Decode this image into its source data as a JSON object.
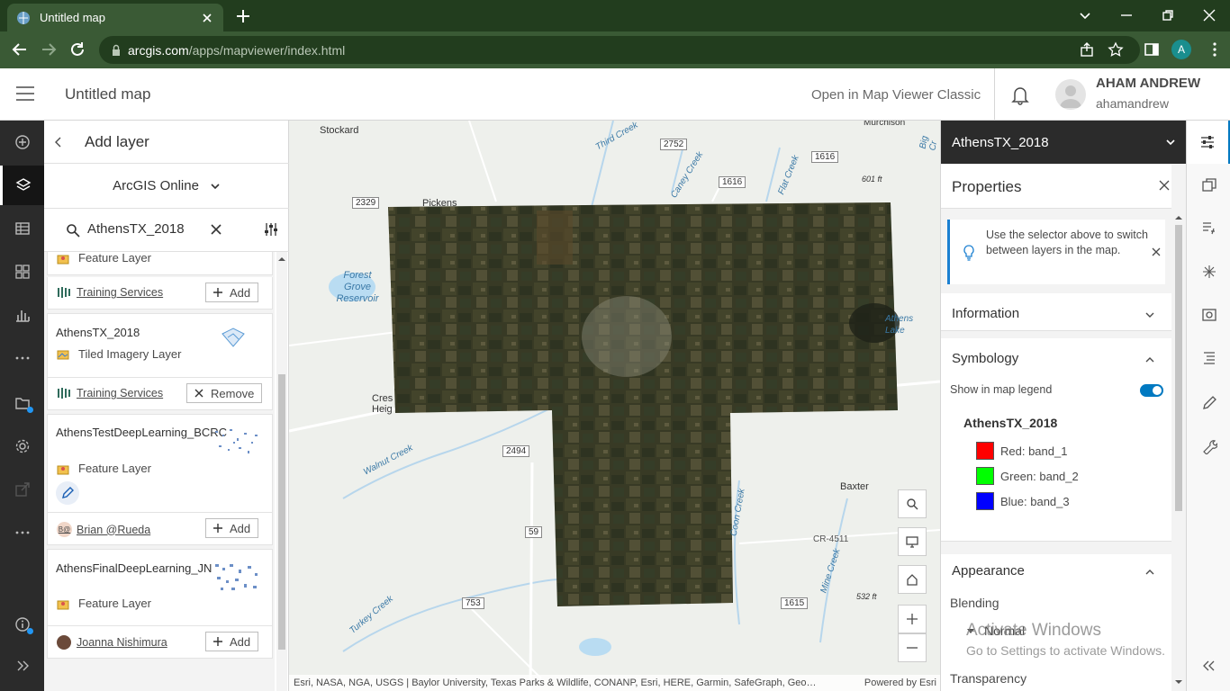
{
  "browser": {
    "tab_title": "Untitled map",
    "url_host": "arcgis.com",
    "url_path": "/apps/mapviewer/index.html",
    "profile_initial": "A"
  },
  "header": {
    "map_title": "Untitled map",
    "classic_link": "Open in Map Viewer Classic",
    "user_name": "AHAM ANDREW",
    "user_login": "ahamandrew"
  },
  "add_layer": {
    "title": "Add layer",
    "source": "ArcGIS Online",
    "search_value": "AthensTX_2018",
    "items": [
      {
        "name": "",
        "type": "Feature Layer",
        "owner": "Training Services",
        "action": "Add"
      },
      {
        "name": "AthensTX_2018",
        "type": "Tiled Imagery Layer",
        "owner": "Training Services",
        "action": "Remove"
      },
      {
        "name": "AthensTestDeepLearning_BCRC",
        "type": "Feature Layer",
        "owner": "Brian @Rueda",
        "owner_initials": "B@",
        "action": "Add"
      },
      {
        "name": "AthensFinalDeepLearning_JN",
        "type": "Feature Layer",
        "owner": "Joanna Nishimura",
        "action": "Add"
      }
    ]
  },
  "map": {
    "labels": [
      "Stockard",
      "Pickens",
      "Forest Grove Reservoir",
      "Cres Heig",
      "Baxter",
      "Murchison",
      "Athens Lake",
      "Walnut Creek",
      "Turkey Creek",
      "Coon Creek",
      "Mine Creek",
      "Caney Creek",
      "Flat Creek",
      "Third Creek",
      "Big Cr"
    ],
    "roads": [
      "2752",
      "1616",
      "1616",
      "2329",
      "2494",
      "59",
      "753",
      "1615",
      "CR-4511"
    ],
    "elevations": [
      "601 ft",
      "532 ft"
    ],
    "attribution": "Esri, NASA, NGA, USGS | Baylor University, Texas Parks & Wildlife, CONANP, Esri, HERE, Garmin, SafeGraph, Geo…",
    "powered_by": "Powered by Esri"
  },
  "properties": {
    "layer_selector": "AthensTX_2018",
    "title": "Properties",
    "notice": "Use the selector above to switch between layers in the map.",
    "information": "Information",
    "symbology": "Symbology",
    "show_legend": "Show in map legend",
    "legend_title": "AthensTX_2018",
    "bands": [
      {
        "label": "Red: band_1",
        "color": "#ff0000"
      },
      {
        "label": "Green: band_2",
        "color": "#00ff00"
      },
      {
        "label": "Blue: band_3",
        "color": "#0000ff"
      }
    ],
    "appearance": "Appearance",
    "blending": "Blending",
    "blending_value": "Normal",
    "transparency": "Transparency"
  },
  "watermark": {
    "line1": "Activate Windows",
    "line2": "Go to Settings to activate Windows."
  },
  "colors": {
    "accent": "#0079c1",
    "chrome_dark": "#223d1e",
    "chrome": "#3a5a35",
    "toolbar": "#2b2b2b"
  }
}
